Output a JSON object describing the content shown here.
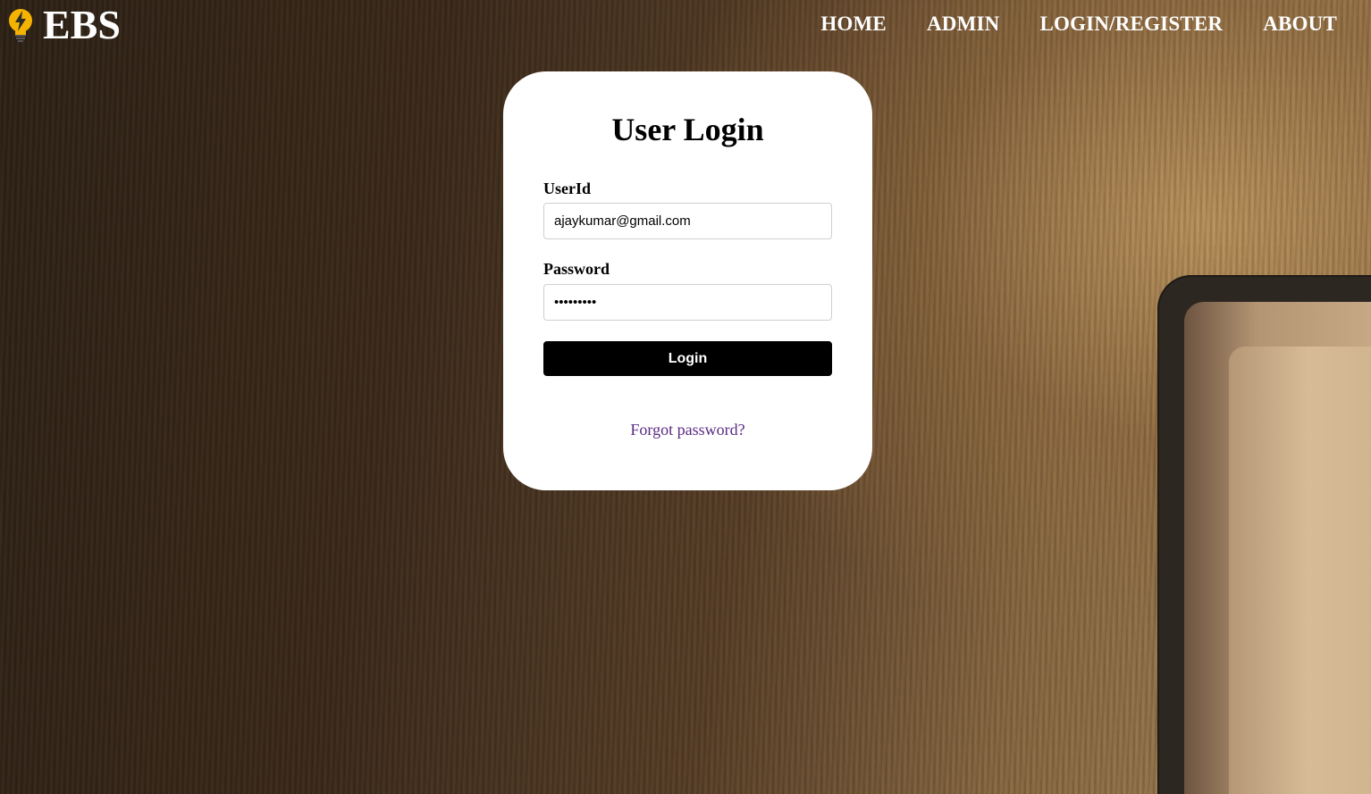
{
  "brand": {
    "name": "EBS",
    "icon": "lightbulb-bolt-icon"
  },
  "nav": {
    "items": [
      {
        "label": "HOME"
      },
      {
        "label": "ADMIN"
      },
      {
        "label": "LOGIN/REGISTER"
      },
      {
        "label": "ABOUT"
      }
    ]
  },
  "login": {
    "title": "User Login",
    "userid_label": "UserId",
    "userid_value": "ajaykumar@gmail.com",
    "password_label": "Password",
    "password_value": "password1",
    "submit_label": "Login",
    "forgot_label": "Forgot password?"
  },
  "colors": {
    "card_bg": "#ffffff",
    "button_bg": "#000000",
    "link": "#5a2a82",
    "bulb": "#f5b301"
  }
}
